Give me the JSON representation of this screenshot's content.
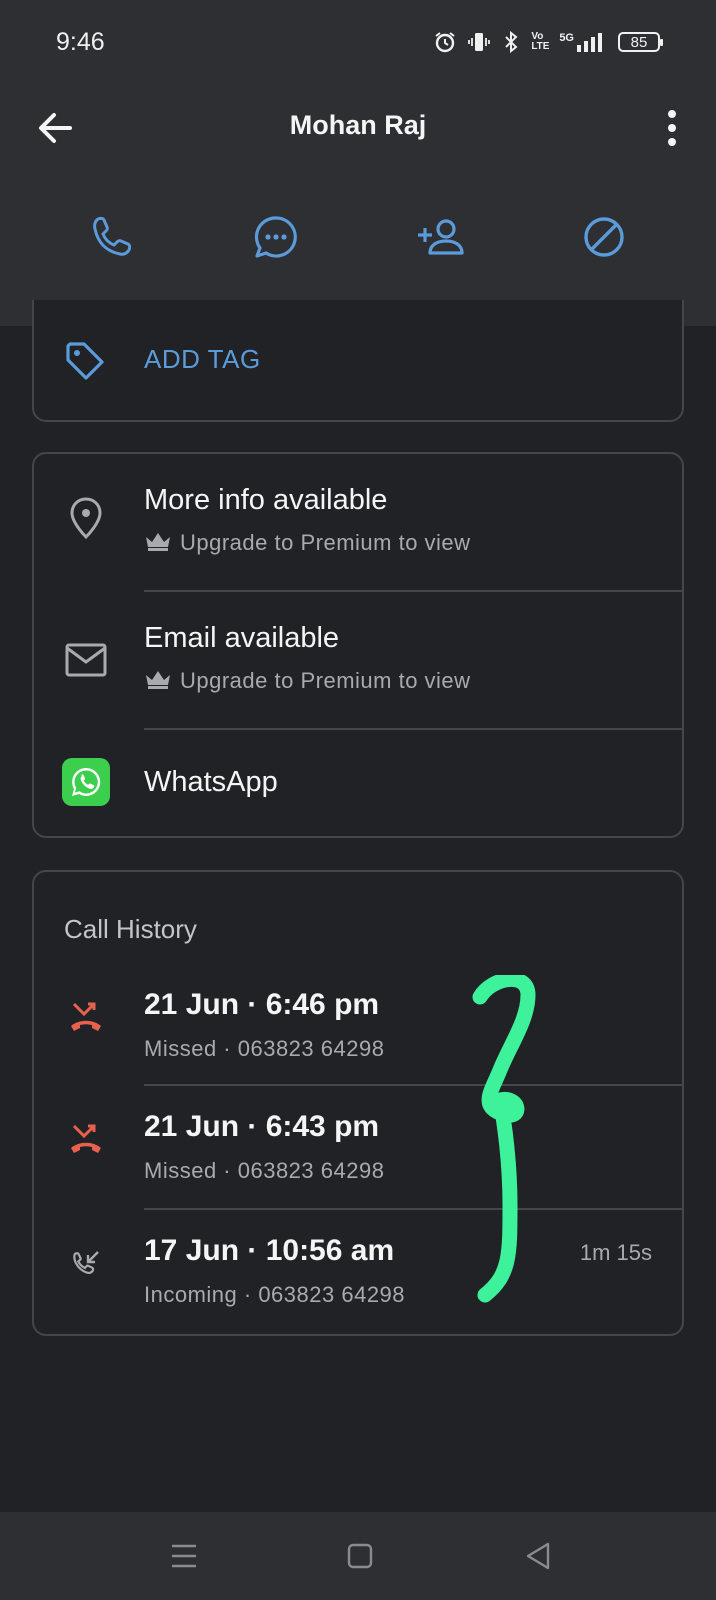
{
  "status_bar": {
    "time": "9:46",
    "network": "5G",
    "volte": "Vo LTE",
    "battery": "85"
  },
  "header": {
    "contact_name": "Mohan Raj",
    "actions": [
      {
        "icon": "phone-icon",
        "label": "Call"
      },
      {
        "icon": "message-icon",
        "label": "Message"
      },
      {
        "icon": "add-contact-icon",
        "label": "Add contact"
      },
      {
        "icon": "block-icon",
        "label": "Block"
      }
    ]
  },
  "tag_card": {
    "add_tag_label": "ADD TAG"
  },
  "info_card": {
    "items": [
      {
        "icon": "location-pin-icon",
        "title": "More info available",
        "subtitle": "Upgrade to Premium to view"
      },
      {
        "icon": "email-icon",
        "title": "Email available",
        "subtitle": "Upgrade to Premium to view"
      },
      {
        "icon": "whatsapp-icon",
        "title": "WhatsApp"
      }
    ]
  },
  "call_history": {
    "title": "Call History",
    "calls": [
      {
        "type": "missed",
        "datetime": "21 Jun · 6:46 pm",
        "detail": "Missed · 063823 64298",
        "duration": ""
      },
      {
        "type": "missed",
        "datetime": "21 Jun · 6:43 pm",
        "detail": "Missed · 063823 64298",
        "duration": ""
      },
      {
        "type": "incoming",
        "datetime": "17 Jun · 10:56 am",
        "detail": "Incoming · 063823 64298",
        "duration": "1m 15s"
      }
    ]
  },
  "colors": {
    "accent": "#5b9bd9",
    "missed": "#e8614f",
    "whatsapp": "#3ccf4e",
    "annotation": "#3df29a",
    "background": "#212226",
    "header": "#2e2f33"
  }
}
